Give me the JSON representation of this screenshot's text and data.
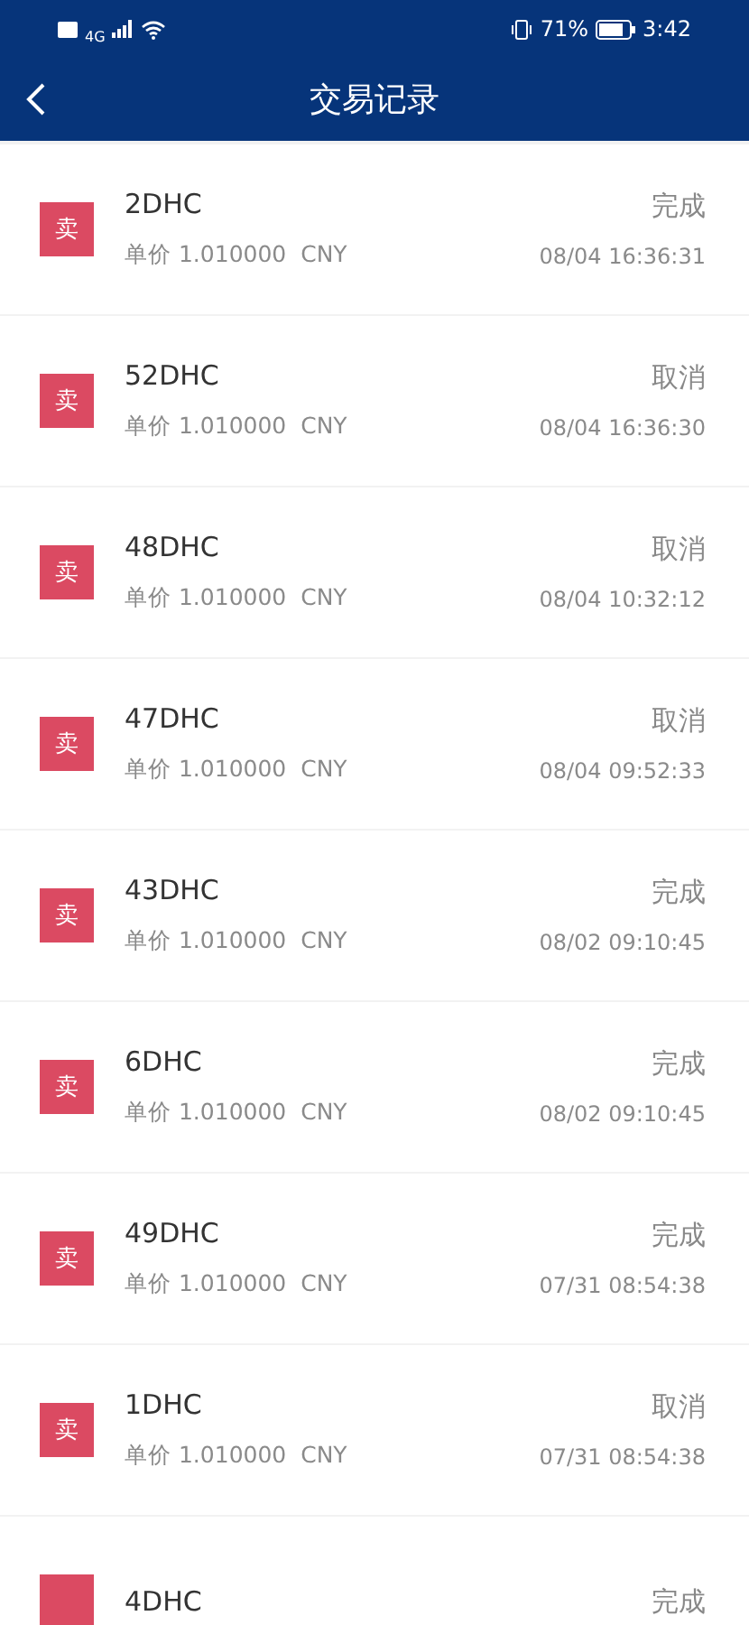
{
  "status_bar": {
    "network": "4G",
    "battery": "71%",
    "time": "3:42"
  },
  "header": {
    "title": "交易记录"
  },
  "records": [
    {
      "side": "卖",
      "amount": "2DHC",
      "price_label": "单价",
      "price": "1.010000",
      "currency": "CNY",
      "status": "完成",
      "time": "08/04 16:36:31"
    },
    {
      "side": "卖",
      "amount": "52DHC",
      "price_label": "单价",
      "price": "1.010000",
      "currency": "CNY",
      "status": "取消",
      "time": "08/04 16:36:30"
    },
    {
      "side": "卖",
      "amount": "48DHC",
      "price_label": "单价",
      "price": "1.010000",
      "currency": "CNY",
      "status": "取消",
      "time": "08/04 10:32:12"
    },
    {
      "side": "卖",
      "amount": "47DHC",
      "price_label": "单价",
      "price": "1.010000",
      "currency": "CNY",
      "status": "取消",
      "time": "08/04 09:52:33"
    },
    {
      "side": "卖",
      "amount": "43DHC",
      "price_label": "单价",
      "price": "1.010000",
      "currency": "CNY",
      "status": "完成",
      "time": "08/02 09:10:45"
    },
    {
      "side": "卖",
      "amount": "6DHC",
      "price_label": "单价",
      "price": "1.010000",
      "currency": "CNY",
      "status": "完成",
      "time": "08/02 09:10:45"
    },
    {
      "side": "卖",
      "amount": "49DHC",
      "price_label": "单价",
      "price": "1.010000",
      "currency": "CNY",
      "status": "完成",
      "time": "07/31 08:54:38"
    },
    {
      "side": "卖",
      "amount": "1DHC",
      "price_label": "单价",
      "price": "1.010000",
      "currency": "CNY",
      "status": "取消",
      "time": "07/31 08:54:38"
    },
    {
      "amount": "4DHC",
      "status": "完成"
    }
  ]
}
